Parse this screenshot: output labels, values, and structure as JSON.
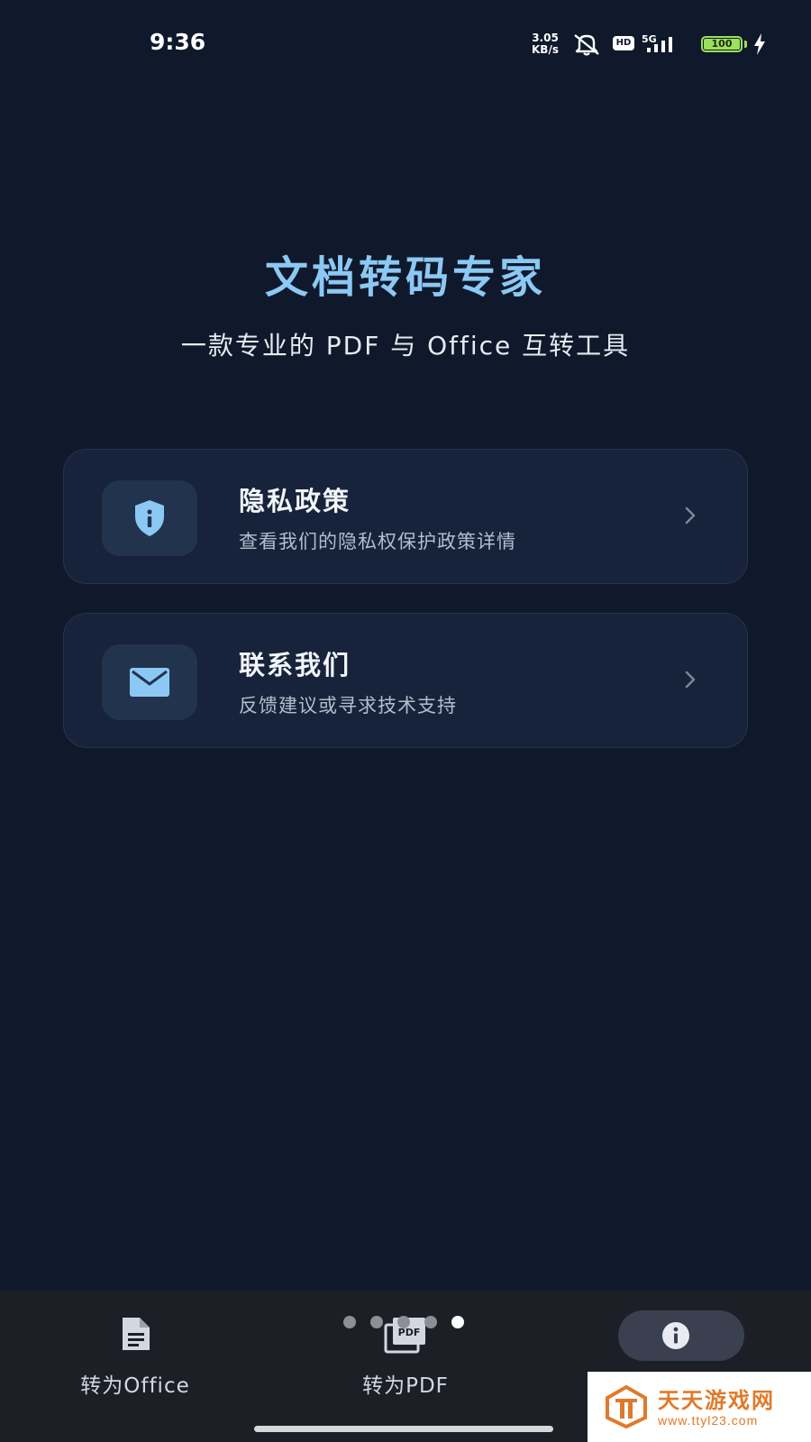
{
  "status_bar": {
    "time": "9:36",
    "net_speed_value": "3.05",
    "net_speed_unit": "KB/s",
    "hd_label": "HD",
    "network_label": "5G",
    "battery_level": "100"
  },
  "header": {
    "title": "文档转码专家",
    "subtitle": "一款专业的 PDF 与 Office 互转工具"
  },
  "cards": [
    {
      "title": "隐私政策",
      "description": "查看我们的隐私权保护政策详情",
      "icon": "shield-info-icon"
    },
    {
      "title": "联系我们",
      "description": "反馈建议或寻求技术支持",
      "icon": "mail-icon"
    }
  ],
  "bottom_nav": {
    "items": [
      {
        "label": "转为Office",
        "icon": "document-icon"
      },
      {
        "label": "转为PDF",
        "icon": "pdf-stack-icon"
      },
      {
        "label": "",
        "icon": "info-icon",
        "selected": true
      }
    ],
    "page_dots": {
      "count": 5,
      "active_index": 4
    }
  },
  "watermark": {
    "name": "天天游戏网",
    "url": "www.ttyl23.com"
  },
  "colors": {
    "background": "#0f192b",
    "accent": "#8cc8f4",
    "card": "#17233a",
    "nav": "#1c1f26",
    "battery": "#9be15d",
    "watermark": "#e07a2a"
  }
}
